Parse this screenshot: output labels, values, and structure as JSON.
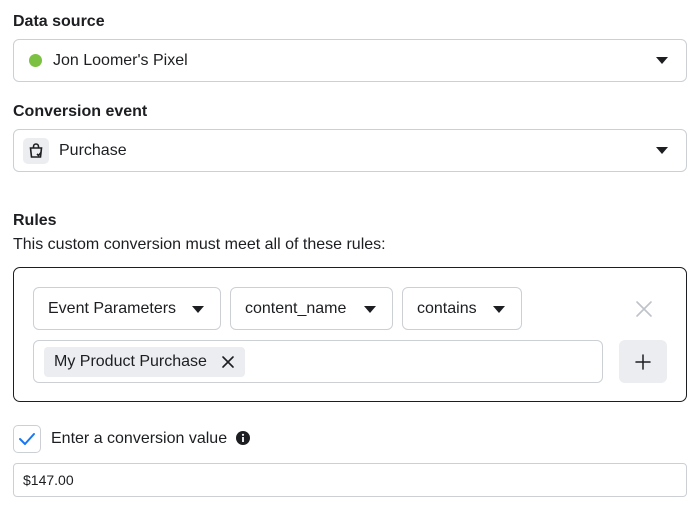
{
  "data_source": {
    "label": "Data source",
    "selected": "Jon Loomer's Pixel",
    "status_color": "#7dc142"
  },
  "conversion_event": {
    "label": "Conversion event",
    "selected": "Purchase",
    "icon": "shopping-bag-icon"
  },
  "rules": {
    "label": "Rules",
    "description": "This custom conversion must meet all of these rules:",
    "selectors": [
      "Event Parameters",
      "content_name",
      "contains"
    ],
    "tags": [
      "My Product Purchase"
    ],
    "add_symbol": "+"
  },
  "conversion_value": {
    "checkbox_checked": true,
    "label": "Enter a conversion value",
    "value": "$147.00"
  },
  "colors": {
    "accent": "#1877f2",
    "border": "#ccd0d5",
    "chip_bg": "#ebedf0"
  }
}
